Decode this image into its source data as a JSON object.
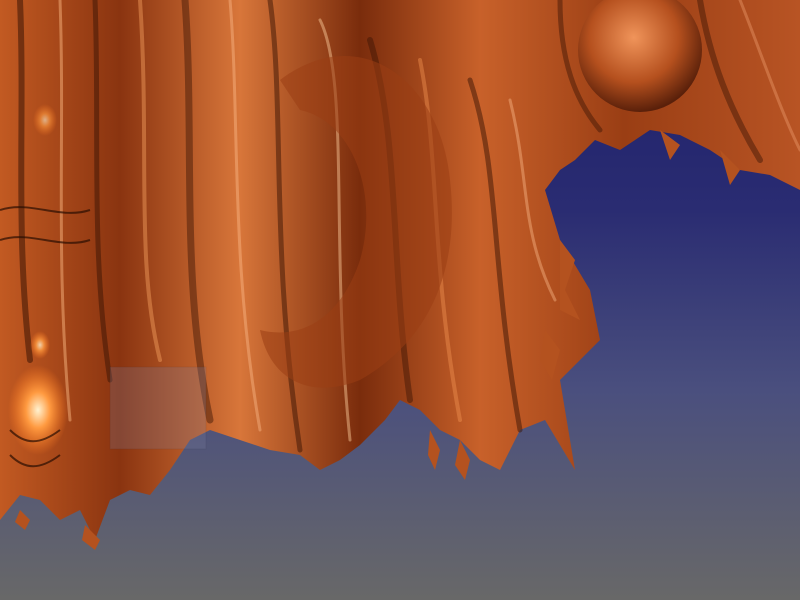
{
  "scene": {
    "subject": "fractal-render",
    "colors": {
      "sky_top": "#1d1f6a",
      "sky_mid": "#3a3f7a",
      "sky_bottom": "#676767",
      "copper_dark": "#3a1404",
      "copper_mid": "#a8451a",
      "copper_light": "#e07a3a",
      "copper_highlight": "#ffd0a0"
    }
  }
}
